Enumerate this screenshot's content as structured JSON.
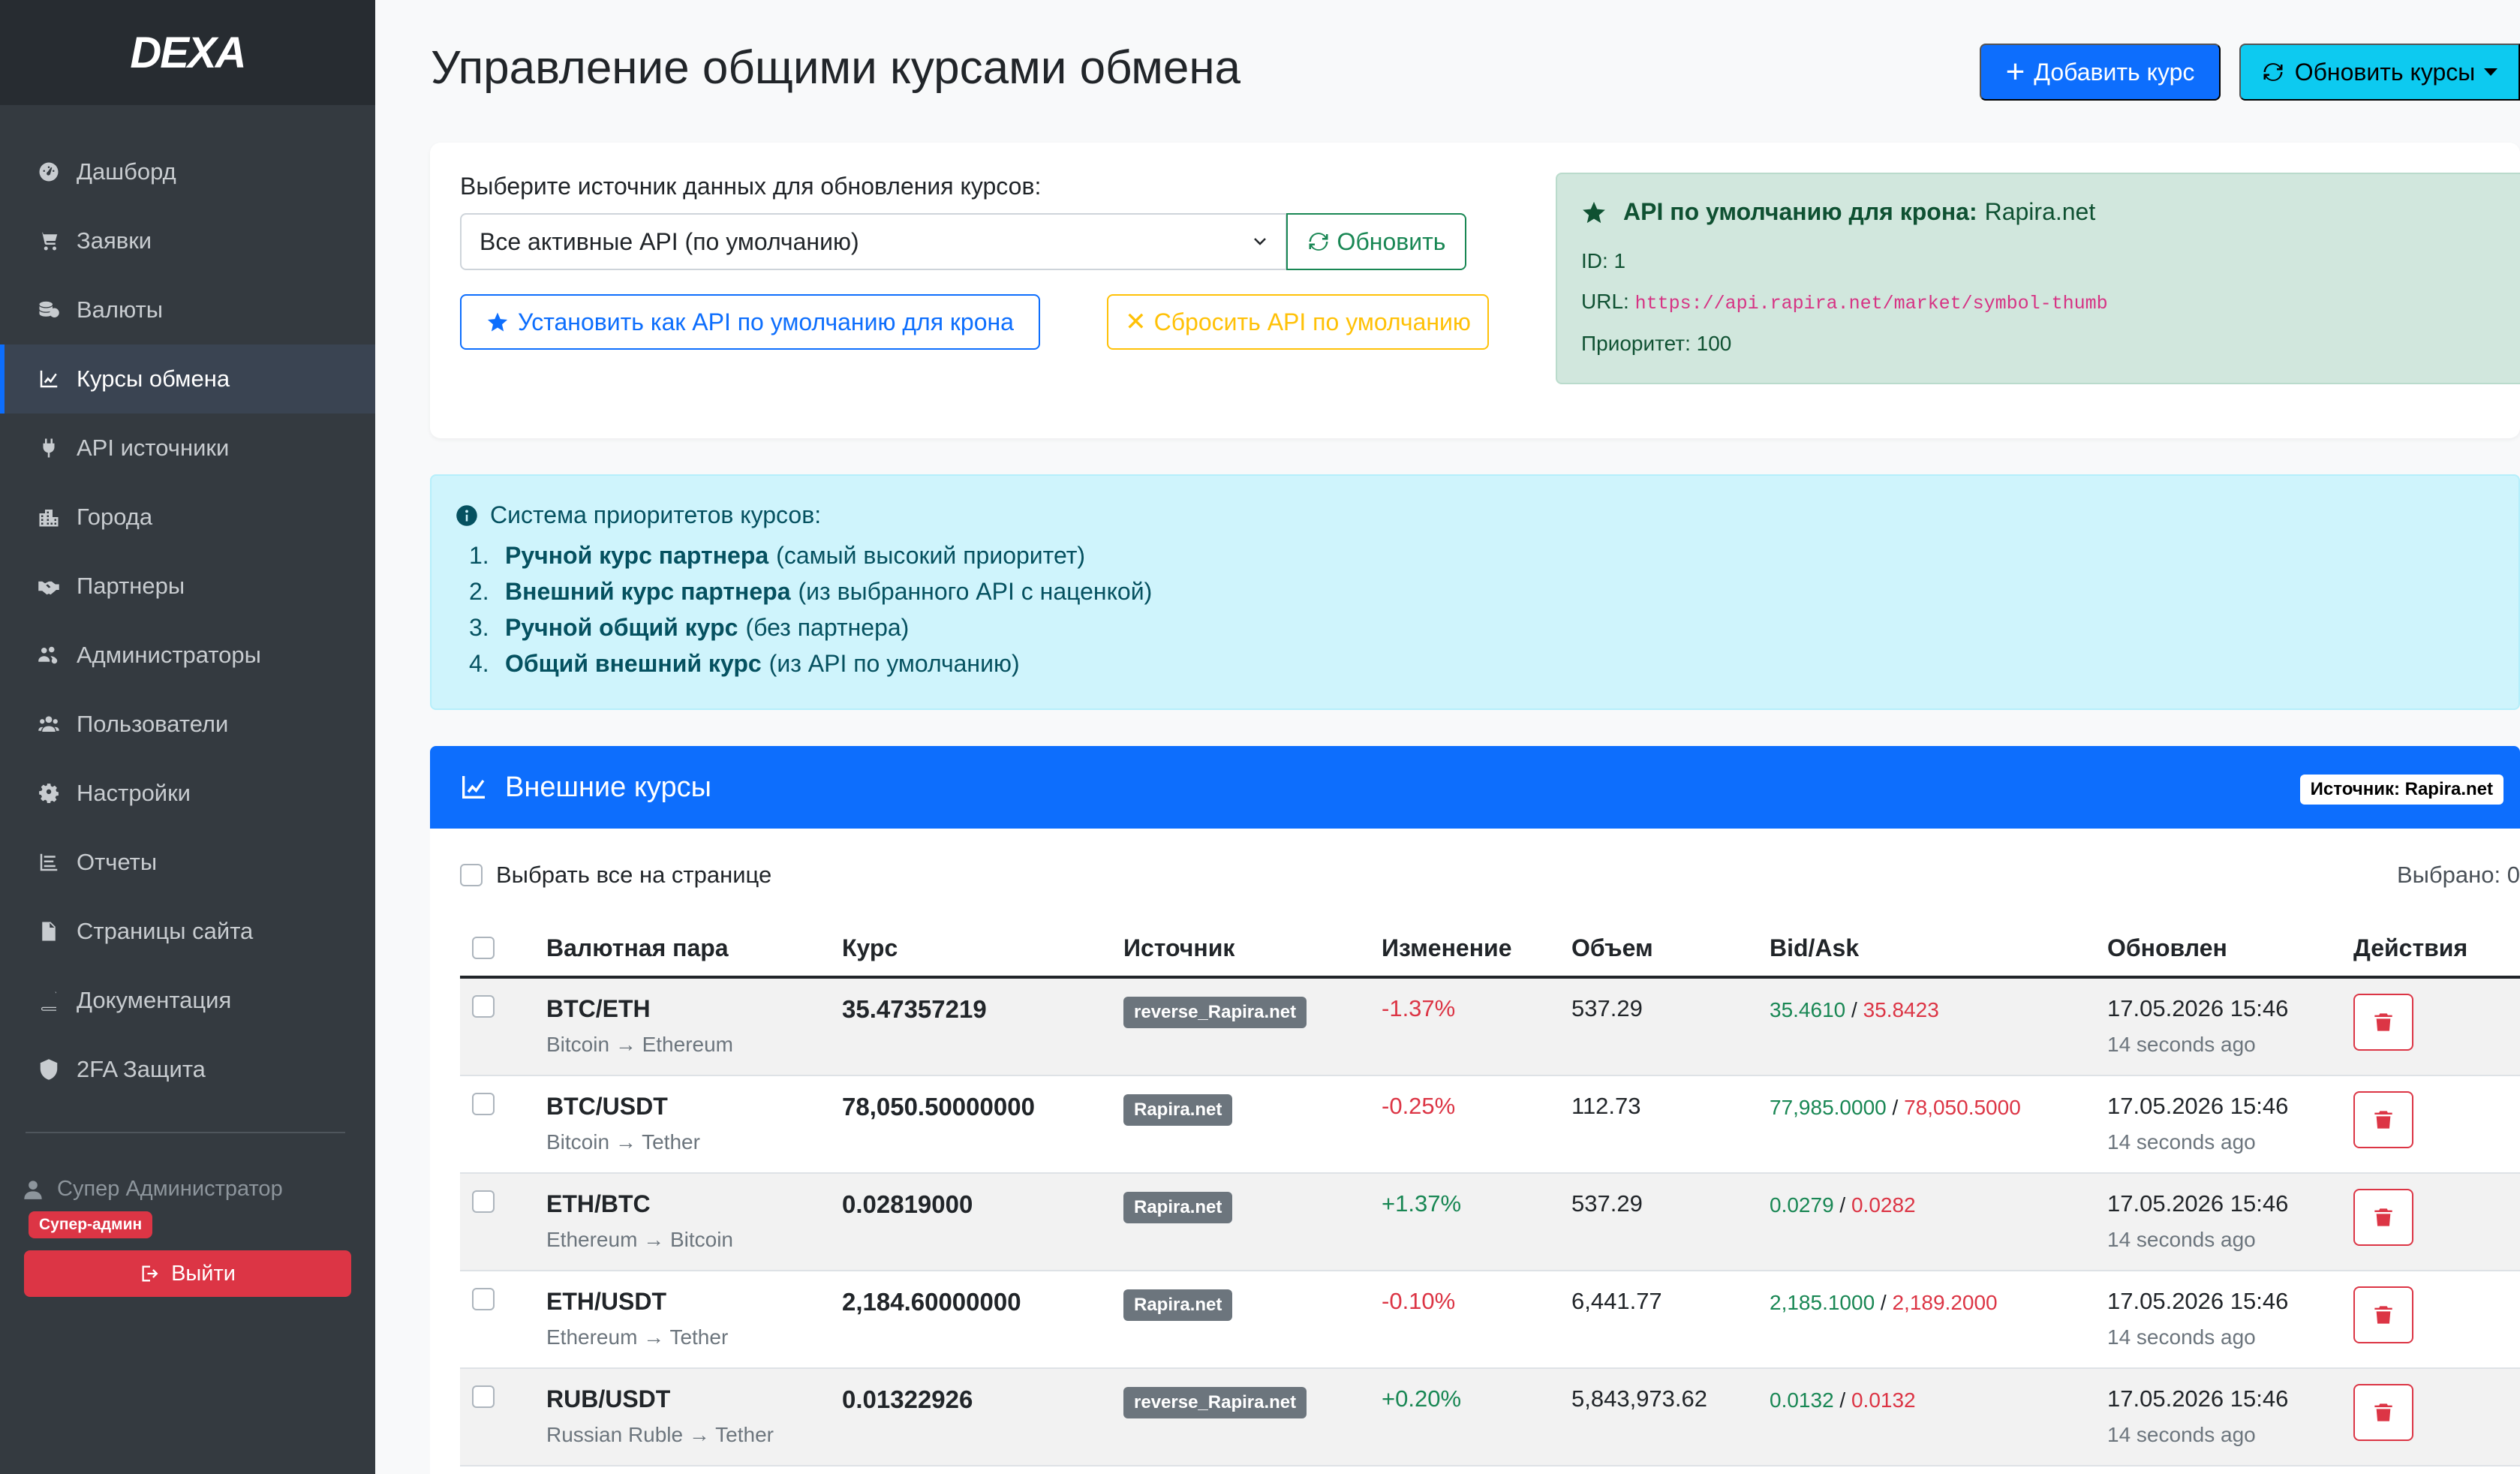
{
  "brand": {
    "logo_text": "DEXA"
  },
  "sidebar": {
    "items": [
      {
        "label": "Дашборд",
        "icon": "tachometer-icon"
      },
      {
        "label": "Заявки",
        "icon": "cart-icon"
      },
      {
        "label": "Валюты",
        "icon": "coins-icon"
      },
      {
        "label": "Курсы обмена",
        "icon": "chart-line-icon",
        "active": true
      },
      {
        "label": "API источники",
        "icon": "plug-icon"
      },
      {
        "label": "Города",
        "icon": "city-icon"
      },
      {
        "label": "Партнеры",
        "icon": "handshake-icon"
      },
      {
        "label": "Администраторы",
        "icon": "users-cog-icon"
      },
      {
        "label": "Пользователи",
        "icon": "users-icon"
      },
      {
        "label": "Настройки",
        "icon": "gear-icon"
      },
      {
        "label": "Отчеты",
        "icon": "list-icon"
      },
      {
        "label": "Страницы сайта",
        "icon": "file-icon"
      },
      {
        "label": "Документация",
        "icon": "book-icon"
      },
      {
        "label": "2FA Защита",
        "icon": "shield-icon"
      }
    ],
    "user_name": "Супер Администратор",
    "role_badge": "Супер-админ",
    "logout_label": "Выйти"
  },
  "header": {
    "title": "Управление общими курсами обмена",
    "add_label": "Добавить курс",
    "refresh_label": "Обновить курсы"
  },
  "source": {
    "label": "Выберите источник данных для обновления курсов:",
    "selected": "Все активные API (по умолчанию)",
    "update_label": "Обновить",
    "set_default_label": "Установить как API по умолчанию для крона",
    "reset_label": "Сбросить API по умолчанию"
  },
  "default_api": {
    "title": "API по умолчанию для крона:",
    "name": "Rapira.net",
    "id_line": "ID: 1",
    "url_label": "URL:",
    "url": "https://api.rapira.net/market/symbol-thumb",
    "priority_line": "Приоритет: 100"
  },
  "priority_info": {
    "title": "Система приоритетов курсов:",
    "items": [
      {
        "num": "1.",
        "bold": "Ручной курс партнера",
        "rest": "(самый высокий приоритет)"
      },
      {
        "num": "2.",
        "bold": "Внешний курс партнера",
        "rest": "(из выбранного API с наценкой)"
      },
      {
        "num": "3.",
        "bold": "Ручной общий курс",
        "rest": "(без партнера)"
      },
      {
        "num": "4.",
        "bold": "Общий внешний курс",
        "rest": "(из API по умолчанию)"
      }
    ]
  },
  "rates": {
    "title": "Внешние курсы",
    "source_badge": "Источник: Rapira.net",
    "select_all_label": "Выбрать все на странице",
    "selected_count": "Выбрано: 0",
    "columns": [
      "Валютная пара",
      "Курс",
      "Источник",
      "Изменение",
      "Объем",
      "Bid/Ask",
      "Обновлен",
      "Действия"
    ],
    "rows": [
      {
        "pair": "BTC/ETH",
        "sub": "Bitcoin → Ethereum",
        "rate": "35.47357219",
        "source": "reverse_Rapira.net",
        "change": "-1.37%",
        "change_sign": "neg",
        "volume": "537.29",
        "bid": "35.4610",
        "ask": "35.8423",
        "updated": "17.05.2026 15:46",
        "ago": "14 seconds ago"
      },
      {
        "pair": "BTC/USDT",
        "sub": "Bitcoin → Tether",
        "rate": "78,050.50000000",
        "source": "Rapira.net",
        "change": "-0.25%",
        "change_sign": "neg",
        "volume": "112.73",
        "bid": "77,985.0000",
        "ask": "78,050.5000",
        "updated": "17.05.2026 15:46",
        "ago": "14 seconds ago"
      },
      {
        "pair": "ETH/BTC",
        "sub": "Ethereum → Bitcoin",
        "rate": "0.02819000",
        "source": "Rapira.net",
        "change": "+1.37%",
        "change_sign": "pos",
        "volume": "537.29",
        "bid": "0.0279",
        "ask": "0.0282",
        "updated": "17.05.2026 15:46",
        "ago": "14 seconds ago"
      },
      {
        "pair": "ETH/USDT",
        "sub": "Ethereum → Tether",
        "rate": "2,184.60000000",
        "source": "Rapira.net",
        "change": "-0.10%",
        "change_sign": "neg",
        "volume": "6,441.77",
        "bid": "2,185.1000",
        "ask": "2,189.2000",
        "updated": "17.05.2026 15:46",
        "ago": "14 seconds ago"
      },
      {
        "pair": "RUB/USDT",
        "sub": "Russian Ruble → Tether",
        "rate": "0.01322926",
        "source": "reverse_Rapira.net",
        "change": "+0.20%",
        "change_sign": "pos",
        "volume": "5,843,973.62",
        "bid": "0.0132",
        "ask": "0.0132",
        "updated": "17.05.2026 15:46",
        "ago": "14 seconds ago"
      }
    ]
  },
  "colors": {
    "primary": "#0d6efd",
    "info": "#0dcaf0",
    "success": "#198754",
    "danger": "#dc3545",
    "warning": "#ffc107",
    "sidebar": "#343a40"
  }
}
